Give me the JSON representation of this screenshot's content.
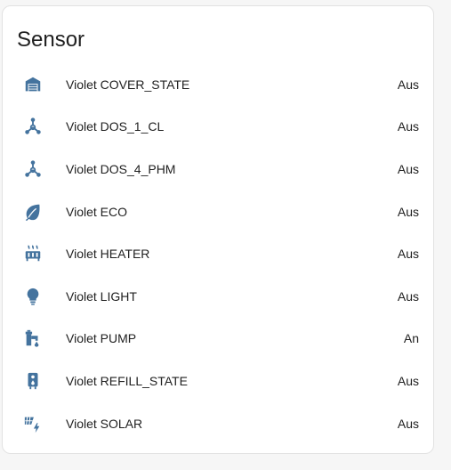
{
  "card": {
    "title": "Sensor",
    "icon_color": "#44739e",
    "entities": [
      {
        "icon": "garage-icon",
        "name": "Violet COVER_STATE",
        "state": "Aus"
      },
      {
        "icon": "molecule-icon",
        "name": "Violet DOS_1_CL",
        "state": "Aus"
      },
      {
        "icon": "molecule-icon",
        "name": "Violet DOS_4_PHM",
        "state": "Aus"
      },
      {
        "icon": "leaf-icon",
        "name": "Violet ECO",
        "state": "Aus"
      },
      {
        "icon": "radiator-icon",
        "name": "Violet HEATER",
        "state": "Aus"
      },
      {
        "icon": "lightbulb-icon",
        "name": "Violet LIGHT",
        "state": "Aus"
      },
      {
        "icon": "water-pump-icon",
        "name": "Violet PUMP",
        "state": "An"
      },
      {
        "icon": "water-boiler-icon",
        "name": "Violet REFILL_STATE",
        "state": "Aus"
      },
      {
        "icon": "solar-power-icon",
        "name": "Violet SOLAR",
        "state": "Aus"
      }
    ]
  }
}
